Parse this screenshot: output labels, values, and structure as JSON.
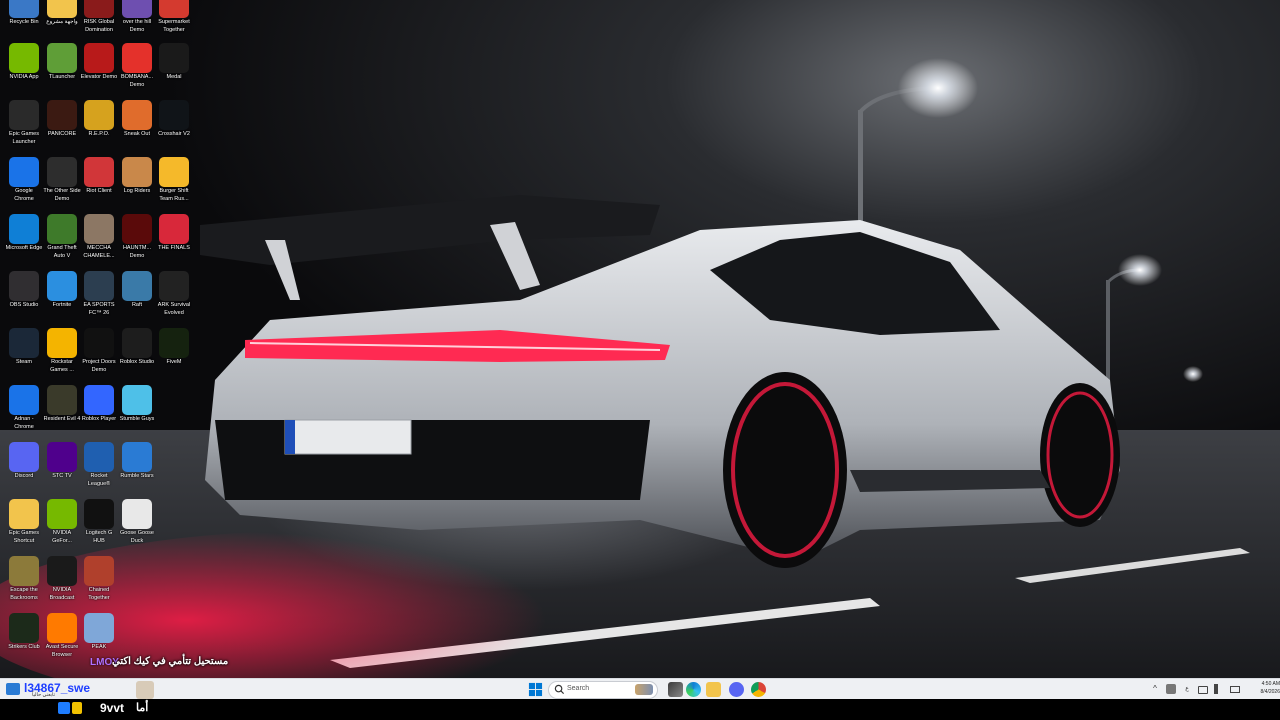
{
  "desktop": {
    "icons": [
      {
        "label": "Recycle Bin",
        "icon": "recycle-bin-icon",
        "color": "#3a78c6"
      },
      {
        "label": "واجهة مشروع",
        "icon": "folder-icon",
        "color": "#f2c44c"
      },
      {
        "label": "RISK Global Domination",
        "icon": "risk-icon",
        "color": "#8a1b1b"
      },
      {
        "label": "over the hill Demo",
        "icon": "over-the-hill-icon",
        "color": "#6e4fb0"
      },
      {
        "label": "Supermarket Together",
        "icon": "supermarket-icon",
        "color": "#d43a2f"
      },
      {
        "label": "NVIDIA App",
        "icon": "nvidia-icon",
        "color": "#76b900"
      },
      {
        "label": "TLauncher",
        "icon": "tlauncher-icon",
        "color": "#5f9e37"
      },
      {
        "label": "Elevator Demo",
        "icon": "elevator-icon",
        "color": "#b81a1a"
      },
      {
        "label": "BOMBANA... Demo",
        "icon": "bombana-icon",
        "color": "#e4312b"
      },
      {
        "label": "Medal",
        "icon": "medal-icon",
        "color": "#1a1a1a"
      },
      {
        "label": "Epic Games Launcher",
        "icon": "epic-games-icon",
        "color": "#2a2a2a"
      },
      {
        "label": "PANICORE",
        "icon": "panicore-icon",
        "color": "#3b1a12"
      },
      {
        "label": "R.E.P.O.",
        "icon": "repo-icon",
        "color": "#d6a21e"
      },
      {
        "label": "Sneak Out",
        "icon": "sneak-out-icon",
        "color": "#e06c2c"
      },
      {
        "label": "Crosshair V2",
        "icon": "crosshair-icon",
        "color": "#101418"
      },
      {
        "label": "Google Chrome",
        "icon": "chrome-icon",
        "color": "#1a73e8"
      },
      {
        "label": "The Other Side Demo",
        "icon": "other-side-icon",
        "color": "#2d2d2d"
      },
      {
        "label": "Riot Client",
        "icon": "riot-client-icon",
        "color": "#d13639"
      },
      {
        "label": "Log Riders",
        "icon": "log-riders-icon",
        "color": "#c9884a"
      },
      {
        "label": "Burger Shift Team Rus...",
        "icon": "burger-shift-icon",
        "color": "#f5b92a"
      },
      {
        "label": "Microsoft Edge",
        "icon": "edge-icon",
        "color": "#0f7fd6"
      },
      {
        "label": "Grand Theft Auto V",
        "icon": "gta-icon",
        "color": "#3e7a2a"
      },
      {
        "label": "MECCHA CHAMELE...",
        "icon": "meccha-icon",
        "color": "#8c7764"
      },
      {
        "label": "HAUNTM... Demo",
        "icon": "hauntm-icon",
        "color": "#5a0a0a"
      },
      {
        "label": "THE FINALS",
        "icon": "the-finals-icon",
        "color": "#d8283a"
      },
      {
        "label": "OBS Studio",
        "icon": "obs-icon",
        "color": "#302e31"
      },
      {
        "label": "Fortnite",
        "icon": "fortnite-icon",
        "color": "#2b8fe0"
      },
      {
        "label": "EA SPORTS FC™ 26",
        "icon": "ea-fc-icon",
        "color": "#2c3e50"
      },
      {
        "label": "Raft",
        "icon": "raft-icon",
        "color": "#3a7aa8"
      },
      {
        "label": "ARK Survival Evolved",
        "icon": "ark-icon",
        "color": "#222222"
      },
      {
        "label": "Steam",
        "icon": "steam-icon",
        "color": "#1b2838"
      },
      {
        "label": "Rockstar Games ...",
        "icon": "rockstar-icon",
        "color": "#f4b400"
      },
      {
        "label": "Project Doors Demo",
        "icon": "project-doors-icon",
        "color": "#111111"
      },
      {
        "label": "Roblox Studio",
        "icon": "roblox-studio-icon",
        "color": "#1d1d1d"
      },
      {
        "label": "FiveM",
        "icon": "fivem-icon",
        "color": "#15220f"
      },
      {
        "label": "Adnan - Chrome",
        "icon": "chrome-profile-icon",
        "color": "#1a73e8"
      },
      {
        "label": "Resident Evil 4",
        "icon": "resident-evil-icon",
        "color": "#3a3a2a"
      },
      {
        "label": "Roblox Player",
        "icon": "roblox-player-icon",
        "color": "#3366ff"
      },
      {
        "label": "Stumble Guys",
        "icon": "stumble-guys-icon",
        "color": "#4ec0e8"
      },
      {
        "label": "Discord",
        "icon": "discord-icon",
        "color": "#5865f2"
      },
      {
        "label": "STC TV",
        "icon": "stc-tv-icon",
        "color": "#4f008c"
      },
      {
        "label": "Rocket League®",
        "icon": "rocket-league-icon",
        "color": "#1f5fb0"
      },
      {
        "label": "Rumble Stars",
        "icon": "rumble-stars-icon",
        "color": "#2a7bd4"
      },
      {
        "label": "Epic Games Shortcut",
        "icon": "folder-icon",
        "color": "#f2c44c"
      },
      {
        "label": "NVIDIA GeFor...",
        "icon": "geforce-icon",
        "color": "#76b900"
      },
      {
        "label": "Logitech G HUB",
        "icon": "logitech-icon",
        "color": "#111111"
      },
      {
        "label": "Goose Goose Duck",
        "icon": "goose-icon",
        "color": "#e8e8e8"
      },
      {
        "label": "Escape the Backrooms",
        "icon": "backrooms-icon",
        "color": "#8c7a3a"
      },
      {
        "label": "NVIDIA Broadcast",
        "icon": "broadcast-icon",
        "color": "#1a1a1a"
      },
      {
        "label": "Chained Together",
        "icon": "chained-together-icon",
        "color": "#b0402c"
      },
      {
        "label": "Strikers Club",
        "icon": "strikers-club-icon",
        "color": "#1c2a1a"
      },
      {
        "label": "Avast Secure Browser",
        "icon": "avast-icon",
        "color": "#ff7a00"
      },
      {
        "label": "PEAK",
        "icon": "peak-icon",
        "color": "#7fa7d8"
      }
    ]
  },
  "overlay": {
    "chat_tag": "LMOY",
    "chat_message": "مستحيل تتأمي في كيك اكتي"
  },
  "taskbar": {
    "user_name": "l34867_swe",
    "user_sub": "تابعني حالياً",
    "search_placeholder": "Search",
    "time": "4:50 AM",
    "date": "8/4/2026",
    "accent": "#0067c0"
  },
  "bottom_strip": {
    "text": "9vvt",
    "arabic": "أما"
  }
}
